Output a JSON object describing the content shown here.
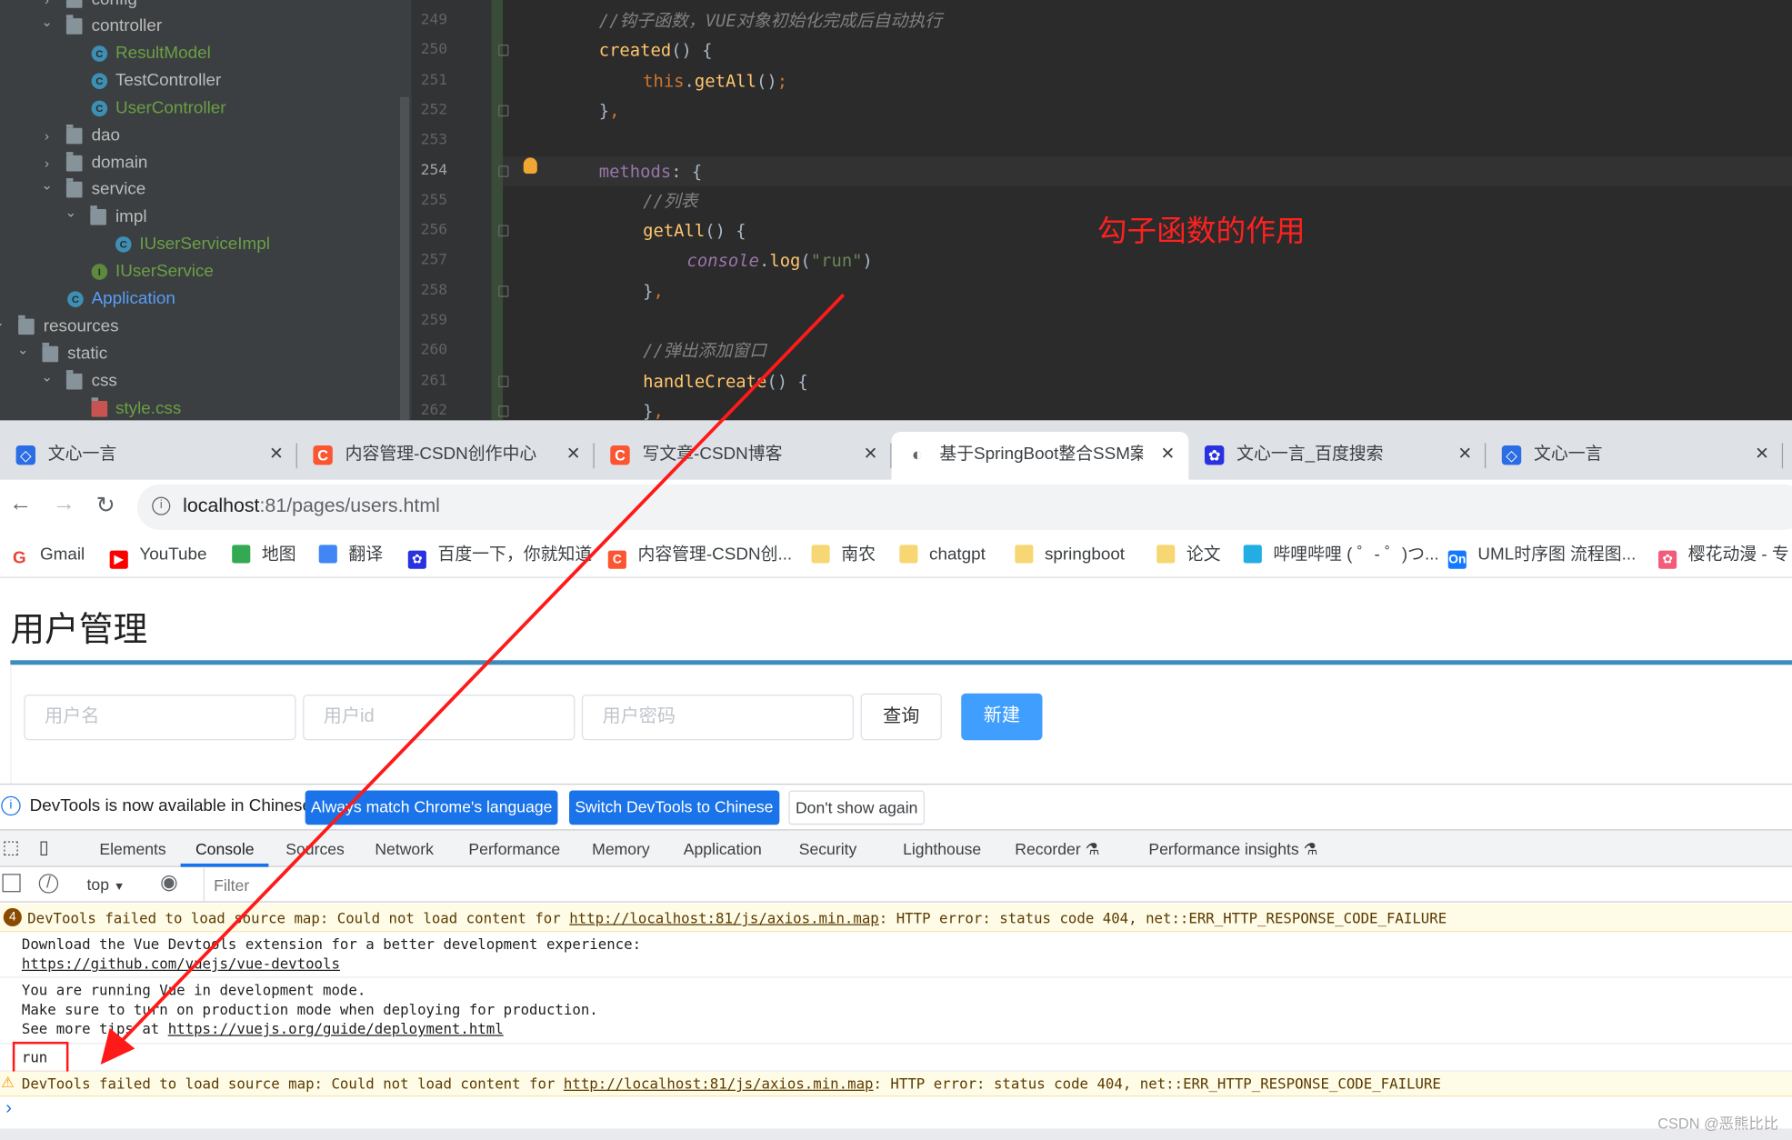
{
  "ide": {
    "tree": [
      {
        "label": "config",
        "indent": 1,
        "type": "folder",
        "open": false,
        "color": "default"
      },
      {
        "label": "controller",
        "indent": 1,
        "type": "folder",
        "open": true,
        "color": "default"
      },
      {
        "label": "ResultModel",
        "indent": 2,
        "type": "class",
        "color": "green"
      },
      {
        "label": "TestController",
        "indent": 2,
        "type": "class",
        "color": "default"
      },
      {
        "label": "UserController",
        "indent": 2,
        "type": "class",
        "color": "green"
      },
      {
        "label": "dao",
        "indent": 1,
        "type": "folder",
        "open": false,
        "color": "default"
      },
      {
        "label": "domain",
        "indent": 1,
        "type": "folder",
        "open": false,
        "color": "default"
      },
      {
        "label": "service",
        "indent": 1,
        "type": "folder",
        "open": true,
        "color": "default"
      },
      {
        "label": "impl",
        "indent": 2,
        "type": "folder",
        "open": true,
        "color": "default"
      },
      {
        "label": "IUserServiceImpl",
        "indent": 3,
        "type": "class",
        "color": "green"
      },
      {
        "label": "IUserService",
        "indent": 2,
        "type": "interface",
        "color": "green"
      },
      {
        "label": "Application",
        "indent": 1,
        "type": "app",
        "color": "blue"
      },
      {
        "label": "resources",
        "indent": -1,
        "type": "folder",
        "open": true,
        "color": "default"
      },
      {
        "label": "static",
        "indent": 0,
        "type": "folder",
        "open": true,
        "color": "default"
      },
      {
        "label": "css",
        "indent": 1,
        "type": "folder",
        "open": true,
        "color": "default"
      },
      {
        "label": "style.css",
        "indent": 2,
        "type": "css",
        "color": "green"
      }
    ],
    "line_numbers": [
      "249",
      "250",
      "251",
      "252",
      "253",
      "254",
      "255",
      "256",
      "257",
      "258",
      "259",
      "260",
      "261",
      "262"
    ],
    "current_line": "254",
    "code": [
      {
        "indent": 0,
        "tokens": [
          [
            "cm",
            "//钩子函数，VUE对象初始化完成后自动执行"
          ]
        ]
      },
      {
        "indent": 0,
        "tokens": [
          [
            "fn",
            "created"
          ],
          [
            "",
            "() {"
          ]
        ]
      },
      {
        "indent": 1,
        "tokens": [
          [
            "kw",
            "this"
          ],
          [
            "",
            "."
          ],
          [
            "fn",
            "getAll"
          ],
          [
            "",
            "()"
          ],
          [
            "kw",
            ";"
          ]
        ]
      },
      {
        "indent": 0,
        "tokens": [
          [
            "",
            "}"
          ],
          [
            "kw",
            ","
          ]
        ]
      },
      {
        "indent": 0,
        "tokens": []
      },
      {
        "indent": 0,
        "tokens": [
          [
            "pr",
            "methods"
          ],
          [
            "",
            ": {"
          ]
        ]
      },
      {
        "indent": 1,
        "tokens": [
          [
            "cm",
            "//列表"
          ]
        ]
      },
      {
        "indent": 1,
        "tokens": [
          [
            "fn",
            "getAll"
          ],
          [
            "",
            "() {"
          ]
        ]
      },
      {
        "indent": 2,
        "tokens": [
          [
            "pr cm",
            "console"
          ],
          [
            "",
            "."
          ],
          [
            "fn",
            "log"
          ],
          [
            "",
            "("
          ],
          [
            "st",
            "\"run\""
          ],
          [
            "",
            ")"
          ]
        ]
      },
      {
        "indent": 1,
        "tokens": [
          [
            "",
            "}"
          ],
          [
            "kw",
            ","
          ]
        ]
      },
      {
        "indent": 0,
        "tokens": []
      },
      {
        "indent": 1,
        "tokens": [
          [
            "cm",
            "//弹出添加窗口"
          ]
        ]
      },
      {
        "indent": 1,
        "tokens": [
          [
            "fn",
            "handleCreate"
          ],
          [
            "",
            "() {"
          ]
        ]
      },
      {
        "indent": 1,
        "tokens": [
          [
            "",
            "}"
          ],
          [
            "kw",
            ","
          ]
        ]
      }
    ],
    "annotation": "勾子函数的作用"
  },
  "browser": {
    "tabs": [
      {
        "title": "文心一言",
        "icon": "wenxin-icon",
        "color": "#2b6de5",
        "active": false
      },
      {
        "title": "内容管理-CSDN创作中心",
        "icon": "csdn-icon",
        "color": "#fc5531",
        "active": false
      },
      {
        "title": "写文章-CSDN博客",
        "icon": "csdn-icon",
        "color": "#fc5531",
        "active": false
      },
      {
        "title": "基于SpringBoot整合SSM案",
        "icon": "globe-icon",
        "color": "#5f6368",
        "active": true
      },
      {
        "title": "文心一言_百度搜索",
        "icon": "baidu-icon",
        "color": "#2932e1",
        "active": false
      },
      {
        "title": "文心一言",
        "icon": "wenxin-icon",
        "color": "#2b6de5",
        "active": false
      }
    ],
    "url_host": "localhost",
    "url_rest": ":81/pages/users.html",
    "bookmarks": [
      {
        "label": "Gmail",
        "icon": "google-icon",
        "color": "#4285f4"
      },
      {
        "label": "YouTube",
        "icon": "youtube-icon",
        "color": "#ff0000"
      },
      {
        "label": "地图",
        "icon": "maps-icon",
        "color": "#34a853"
      },
      {
        "label": "翻译",
        "icon": "translate-icon",
        "color": "#4285f4"
      },
      {
        "label": "百度一下，你就知道",
        "icon": "baidu-icon",
        "color": "#2932e1"
      },
      {
        "label": "内容管理-CSDN创...",
        "icon": "csdn-icon",
        "color": "#fc5531"
      },
      {
        "label": "南农",
        "icon": "folder-icon",
        "color": "#f7d774"
      },
      {
        "label": "chatgpt",
        "icon": "folder-icon",
        "color": "#f7d774"
      },
      {
        "label": "springboot",
        "icon": "folder-icon",
        "color": "#f7d774"
      },
      {
        "label": "论文",
        "icon": "folder-icon",
        "color": "#f7d774"
      },
      {
        "label": "哔哩哔哩 ( ゜- ゜)つ...",
        "icon": "bilibili-icon",
        "color": "#23ade5"
      },
      {
        "label": "UML时序图 流程图...",
        "icon": "processon-icon",
        "color": "#1479ff"
      },
      {
        "label": "樱花动漫 - 专",
        "icon": "sakura-icon",
        "color": "#f25c7a"
      }
    ]
  },
  "page": {
    "title": "用户管理",
    "inputs": [
      {
        "placeholder": "用户名"
      },
      {
        "placeholder": "用户id"
      },
      {
        "placeholder": "用户密码"
      }
    ],
    "query_label": "查询",
    "create_label": "新建",
    "accent": "#409eff"
  },
  "devtools": {
    "banner_text": "DevTools is now available in Chinese!",
    "banner_buttons": [
      "Always match Chrome's language",
      "Switch DevTools to Chinese",
      "Don't show again"
    ],
    "tabs": [
      "Elements",
      "Console",
      "Sources",
      "Network",
      "Performance",
      "Memory",
      "Application",
      "Security",
      "Lighthouse",
      "Recorder",
      "Performance insights"
    ],
    "active_tab": "Console",
    "context": "top",
    "filter_placeholder": "Filter",
    "warn_count": "4",
    "messages": {
      "warn1_pre": "DevTools failed to load source map: Could not load content for ",
      "warn_link": "http://localhost:81/js/axios.min.map",
      "warn_post": ": HTTP error: status code 404, net::ERR_HTTP_RESPONSE_CODE_FAILURE",
      "vue1": "Download the Vue Devtools extension for a better development experience:",
      "vue1_link": "https://github.com/vuejs/vue-devtools",
      "vue2a": "You are running Vue in development mode.",
      "vue2b": "Make sure to turn on production mode when deploying for production.",
      "vue2c": "See more tips at ",
      "vue2_link": "https://vuejs.org/guide/deployment.html",
      "run": "run"
    },
    "prompt": "›"
  },
  "watermark": "CSDN @恶熊比比"
}
